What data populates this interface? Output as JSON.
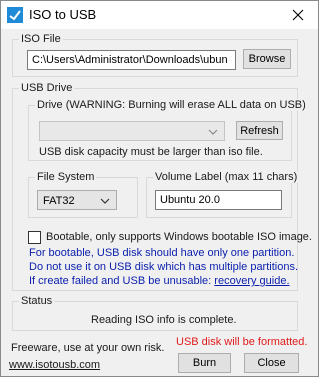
{
  "window": {
    "title": "ISO to USB"
  },
  "iso_file": {
    "group_label": "ISO File",
    "path_value": "C:\\Users\\Administrator\\Downloads\\ubun",
    "browse_label": "Browse"
  },
  "usb_drive": {
    "group_label": "USB Drive",
    "drive_group_label": "Drive (WARNING: Burning will erase ALL data on USB)",
    "drive_selected": "",
    "refresh_label": "Refresh",
    "capacity_note": "USB disk capacity must be larger than iso file.",
    "file_system_label": "File System",
    "file_system_value": "FAT32",
    "volume_label_label": "Volume Label (max 11 chars)",
    "volume_label_value": "Ubuntu 20.0",
    "bootable_label": "Bootable, only supports Windows bootable ISO image.",
    "bootable_checked": false,
    "info_line1": "For bootable, USB disk should have only one partition.",
    "info_line2": "Do not use it on USB disk which has multiple partitions.",
    "info_line3_prefix": "If create failed and USB be unusable:",
    "recovery_link": "recovery guide."
  },
  "status": {
    "group_label": "Status",
    "message": "Reading ISO info is complete."
  },
  "footer": {
    "freeware_text": "Freeware, use at your own risk.",
    "website_link": "www.isotousb.com",
    "format_warning": "USB disk will be formatted.",
    "burn_label": "Burn",
    "close_label": "Close"
  },
  "colors": {
    "info_text": "#0a1ead",
    "warning_text": "#e01b1b"
  },
  "icons": {
    "app": "iso-to-usb-app-icon",
    "close": "close-icon",
    "dropdown": "chevron-down-icon"
  }
}
